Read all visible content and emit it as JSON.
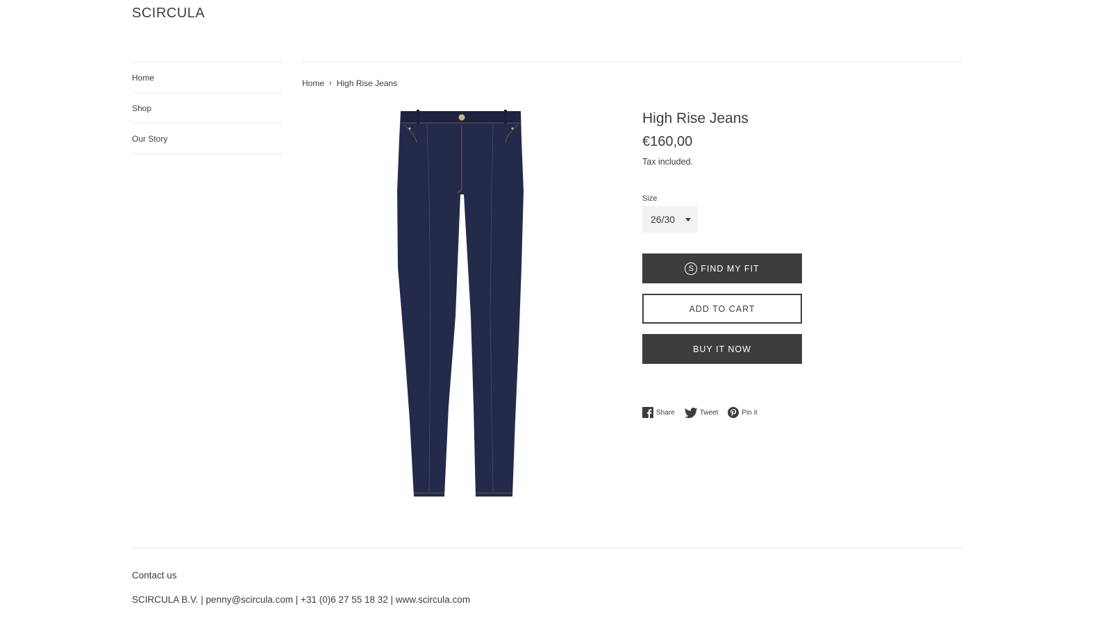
{
  "header": {
    "logo": "SCIRCULA"
  },
  "sidebar": {
    "items": [
      {
        "label": "Home"
      },
      {
        "label": "Shop"
      },
      {
        "label": "Our Story"
      }
    ]
  },
  "breadcrumb": {
    "home": "Home",
    "separator": "›",
    "current": "High Rise Jeans"
  },
  "product": {
    "title": "High Rise Jeans",
    "price": "€160,00",
    "tax_note": "Tax included.",
    "size_label": "Size",
    "size_value": "26/30",
    "find_fit_label": "FIND MY FIT",
    "find_fit_icon_letter": "S",
    "add_to_cart_label": "ADD TO CART",
    "buy_now_label": "BUY IT NOW",
    "image_icon": "jeans-image",
    "denim_color": "#232a4a"
  },
  "share": {
    "facebook": "Share",
    "twitter": "Tweet",
    "pinterest": "Pin it"
  },
  "footer": {
    "title": "Contact us",
    "info": "SCIRCULA B.V. | penny@scircula.com | +31 (0)6 27 55 18 32 | www.scircula.com"
  }
}
